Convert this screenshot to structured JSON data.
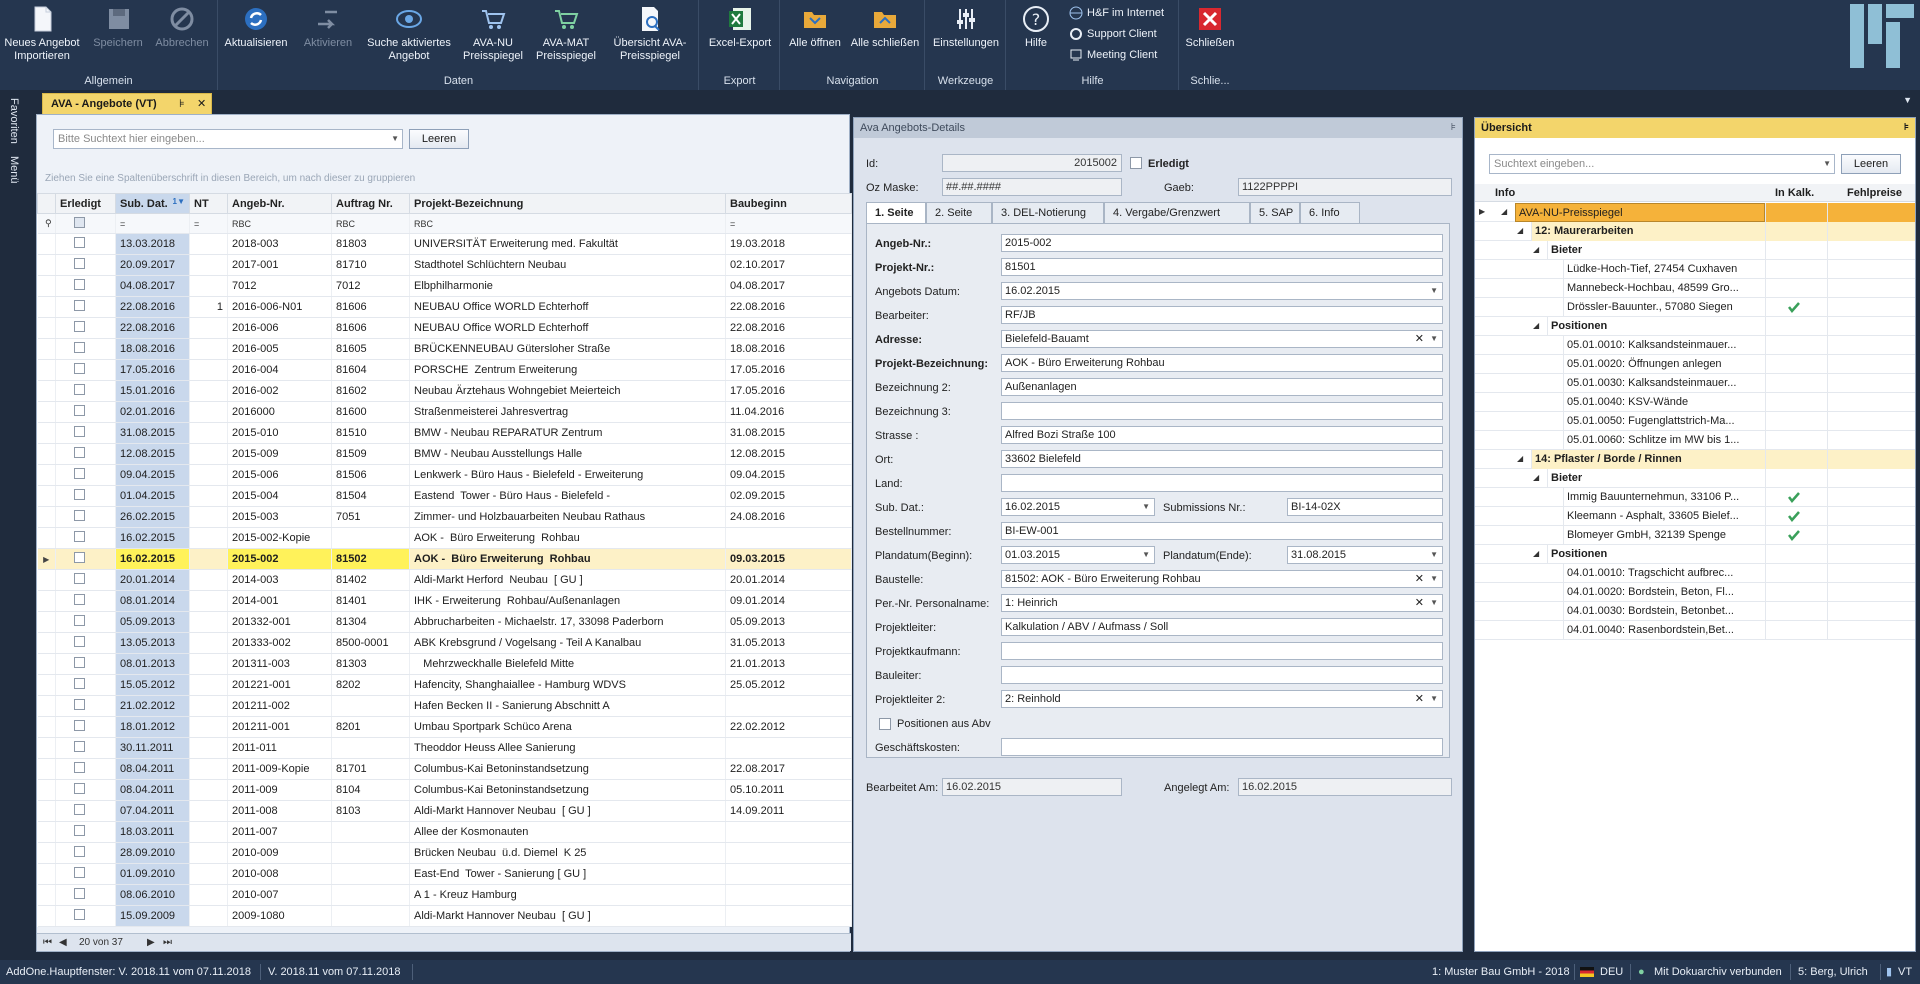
{
  "ribbon": {
    "groups": {
      "allgemein": "Allgemein",
      "daten": "Daten",
      "export": "Export",
      "navigation": "Navigation",
      "werkzeuge": "Werkzeuge",
      "hilfe": "Hilfe",
      "schliessen": "Schlie..."
    },
    "buttons": {
      "neues_angebot": "Neues Angebot Importieren",
      "speichern": "Speichern",
      "abbrechen": "Abbrechen",
      "aktualisieren": "Aktualisieren",
      "aktivieren": "Aktivieren",
      "suche": "Suche aktiviertes Angebot",
      "ava_nu": "AVA-NU Preisspiegel",
      "ava_mat": "AVA-MAT Preisspiegel",
      "uebersicht": "Übersicht AVA-Preisspiegel",
      "excel": "Excel-Export",
      "alle_oeffnen": "Alle öffnen",
      "alle_schliessen": "Alle schließen",
      "einstellungen": "Einstellungen",
      "hilfe": "Hilfe",
      "hf_internet": "H&F im Internet",
      "support": "Support Client",
      "meeting": "Meeting Client",
      "schliessen": "Schließen"
    }
  },
  "side_tabs": {
    "favoriten": "Favoriten",
    "menu": "Menü"
  },
  "doc_tab": {
    "label": "AVA - Angebote (VT)",
    "pin": "⊧",
    "close": "✕"
  },
  "left": {
    "search_placeholder": "Bitte Suchtext hier eingeben...",
    "clear_button": "Leeren",
    "group_hint": "Ziehen Sie eine Spaltenüberschrift in diesen Bereich, um nach dieser zu gruppieren",
    "columns": [
      "Erledigt",
      "Sub. Dat.",
      "NT",
      "Angeb-Nr.",
      "Auftrag Nr.",
      "Projekt-Bezeichnung",
      "Baubeginn"
    ],
    "filter_symbols": [
      "=",
      "=",
      "RBC",
      "RBC",
      "RBC",
      "="
    ],
    "sort_indicator": "1",
    "rows": [
      {
        "sub": "13.03.2018",
        "nt": "",
        "angeb": "2018-003",
        "auftrag": "81803",
        "projekt": "UNIVERSITÄT Erweiterung med. Fakultät",
        "baubeginn": "19.03.2018"
      },
      {
        "sub": "20.09.2017",
        "nt": "",
        "angeb": "2017-001",
        "auftrag": "81710",
        "projekt": "Stadthotel Schlüchtern Neubau",
        "baubeginn": "02.10.2017"
      },
      {
        "sub": "04.08.2017",
        "nt": "",
        "angeb": "7012",
        "auftrag": "7012",
        "projekt": "Elbphilharmonie",
        "baubeginn": "04.08.2017"
      },
      {
        "sub": "22.08.2016",
        "nt": "1",
        "angeb": "2016-006-N01",
        "auftrag": "81606",
        "projekt": "NEUBAU Office WORLD Echterhoff",
        "baubeginn": "22.08.2016"
      },
      {
        "sub": "22.08.2016",
        "nt": "",
        "angeb": "2016-006",
        "auftrag": "81606",
        "projekt": "NEUBAU Office WORLD Echterhoff",
        "baubeginn": "22.08.2016"
      },
      {
        "sub": "18.08.2016",
        "nt": "",
        "angeb": "2016-005",
        "auftrag": "81605",
        "projekt": "BRÜCKENNEUBAU Gütersloher Straße",
        "baubeginn": "18.08.2016"
      },
      {
        "sub": "17.05.2016",
        "nt": "",
        "angeb": "2016-004",
        "auftrag": "81604",
        "projekt": "PORSCHE  Zentrum Erweiterung",
        "baubeginn": "17.05.2016"
      },
      {
        "sub": "15.01.2016",
        "nt": "",
        "angeb": "2016-002",
        "auftrag": "81602",
        "projekt": "Neubau Ärztehaus Wohngebiet Meierteich",
        "baubeginn": "17.05.2016"
      },
      {
        "sub": "02.01.2016",
        "nt": "",
        "angeb": "2016000",
        "auftrag": "81600",
        "projekt": "Straßenmeisterei Jahresvertrag",
        "baubeginn": "11.04.2016"
      },
      {
        "sub": "31.08.2015",
        "nt": "",
        "angeb": "2015-010",
        "auftrag": "81510",
        "projekt": "BMW - Neubau REPARATUR Zentrum",
        "baubeginn": "31.08.2015"
      },
      {
        "sub": "12.08.2015",
        "nt": "",
        "angeb": "2015-009",
        "auftrag": "81509",
        "projekt": "BMW - Neubau Ausstellungs Halle",
        "baubeginn": "12.08.2015"
      },
      {
        "sub": "09.04.2015",
        "nt": "",
        "angeb": "2015-006",
        "auftrag": "81506",
        "projekt": "Lenkwerk - Büro Haus - Bielefeld - Erweiterung",
        "baubeginn": "09.04.2015"
      },
      {
        "sub": "01.04.2015",
        "nt": "",
        "angeb": "2015-004",
        "auftrag": "81504",
        "projekt": "Eastend  Tower - Büro Haus - Bielefeld -",
        "baubeginn": "02.09.2015"
      },
      {
        "sub": "26.02.2015",
        "nt": "",
        "angeb": "2015-003",
        "auftrag": "7051",
        "projekt": "Zimmer- und Holzbauarbeiten Neubau Rathaus",
        "baubeginn": "24.08.2016"
      },
      {
        "sub": "16.02.2015",
        "nt": "",
        "angeb": "2015-002-Kopie",
        "auftrag": "",
        "projekt": "AOK -  Büro Erweiterung  Rohbau",
        "baubeginn": ""
      },
      {
        "sub": "16.02.2015",
        "nt": "",
        "angeb": "2015-002",
        "auftrag": "81502",
        "projekt": "AOK -  Büro Erweiterung  Rohbau",
        "baubeginn": "09.03.2015",
        "selected": true
      },
      {
        "sub": "20.01.2014",
        "nt": "",
        "angeb": "2014-003",
        "auftrag": "81402",
        "projekt": "Aldi-Markt Herford  Neubau  [ GU ]",
        "baubeginn": "20.01.2014"
      },
      {
        "sub": "08.01.2014",
        "nt": "",
        "angeb": "2014-001",
        "auftrag": "81401",
        "projekt": "IHK - Erweiterung  Rohbau/Außenanlagen",
        "baubeginn": "09.01.2014"
      },
      {
        "sub": "05.09.2013",
        "nt": "",
        "angeb": "201332-001",
        "auftrag": "81304",
        "projekt": "Abbrucharbeiten - Michaelstr. 17, 33098 Paderborn",
        "baubeginn": "05.09.2013"
      },
      {
        "sub": "13.05.2013",
        "nt": "",
        "angeb": "201333-002",
        "auftrag": "8500-0001",
        "projekt": "ABK Krebsgrund / Vogelsang - Teil A Kanalbau",
        "baubeginn": "31.05.2013"
      },
      {
        "sub": "08.01.2013",
        "nt": "",
        "angeb": "201311-003",
        "auftrag": "81303",
        "projekt": "   Mehrzweckhalle Bielefeld Mitte",
        "baubeginn": "21.01.2013"
      },
      {
        "sub": "15.05.2012",
        "nt": "",
        "angeb": "201221-001",
        "auftrag": "8202",
        "projekt": "Hafencity, Shanghaiallee - Hamburg WDVS",
        "baubeginn": "25.05.2012"
      },
      {
        "sub": "21.02.2012",
        "nt": "",
        "angeb": "201211-002",
        "auftrag": "",
        "projekt": "Hafen Becken II - Sanierung Abschnitt A",
        "baubeginn": ""
      },
      {
        "sub": "18.01.2012",
        "nt": "",
        "angeb": "201211-001",
        "auftrag": "8201",
        "projekt": "Umbau Sportpark Schüco Arena",
        "baubeginn": "22.02.2012"
      },
      {
        "sub": "30.11.2011",
        "nt": "",
        "angeb": "2011-011",
        "auftrag": "",
        "projekt": "Theoddor Heuss Allee Sanierung",
        "baubeginn": ""
      },
      {
        "sub": "08.04.2011",
        "nt": "",
        "angeb": "2011-009-Kopie",
        "auftrag": "81701",
        "projekt": "Columbus-Kai Betoninstandsetzung",
        "baubeginn": "22.08.2017"
      },
      {
        "sub": "08.04.2011",
        "nt": "",
        "angeb": "2011-009",
        "auftrag": "8104",
        "projekt": "Columbus-Kai Betoninstandsetzung",
        "baubeginn": "05.10.2011"
      },
      {
        "sub": "07.04.2011",
        "nt": "",
        "angeb": "2011-008",
        "auftrag": "8103",
        "projekt": "Aldi-Markt Hannover Neubau  [ GU ]",
        "baubeginn": "14.09.2011"
      },
      {
        "sub": "18.03.2011",
        "nt": "",
        "angeb": "2011-007",
        "auftrag": "",
        "projekt": "Allee der Kosmonauten",
        "baubeginn": ""
      },
      {
        "sub": "28.09.2010",
        "nt": "",
        "angeb": "2010-009",
        "auftrag": "",
        "projekt": "Brücken Neubau  ü.d. Diemel  K 25",
        "baubeginn": ""
      },
      {
        "sub": "01.09.2010",
        "nt": "",
        "angeb": "2010-008",
        "auftrag": "",
        "projekt": "East-End  Tower - Sanierung [ GU ]",
        "baubeginn": ""
      },
      {
        "sub": "08.06.2010",
        "nt": "",
        "angeb": "2010-007",
        "auftrag": "",
        "projekt": "A 1 - Kreuz Hamburg",
        "baubeginn": ""
      },
      {
        "sub": "15.09.2009",
        "nt": "",
        "angeb": "2009-1080",
        "auftrag": "",
        "projekt": "Aldi-Markt Hannover Neubau  [ GU ]",
        "baubeginn": ""
      }
    ],
    "pager_text": "20 von 37"
  },
  "details": {
    "title": "Ava Angebots-Details",
    "id_label": "Id:",
    "id_value": "2015002",
    "erledigt_label": "Erledigt",
    "ozmaske_label": "Oz Maske:",
    "ozmaske_value": "##.##.####",
    "gaeb_label": "Gaeb:",
    "gaeb_value": "1122PPPPI",
    "tabs": [
      "1. Seite",
      "2. Seite",
      "3. DEL-Notierung",
      "4. Vergabe/Grenzwert",
      "5. SAP",
      "6. Info"
    ],
    "fields": {
      "angeb_nr_label": "Angeb-Nr.:",
      "angeb_nr": "2015-002",
      "projekt_nr_label": "Projekt-Nr.:",
      "projekt_nr": "81501",
      "angebots_datum_label": "Angebots Datum:",
      "angebots_datum": "16.02.2015",
      "bearbeiter_label": "Bearbeiter:",
      "bearbeiter": "RF/JB",
      "adresse_label": "Adresse:",
      "adresse": "Bielefeld-Bauamt",
      "projekt_bez_label": "Projekt-Bezeichnung:",
      "projekt_bez": "AOK -  Büro Erweiterung  Rohbau",
      "bez2_label": "Bezeichnung 2:",
      "bez2": "Außenanlagen",
      "bez3_label": "Bezeichnung 3:",
      "bez3": "",
      "strasse_label": "Strasse :",
      "strasse": "Alfred Bozi Straße 100",
      "ort_label": "Ort:",
      "ort": "33602 Bielefeld",
      "land_label": "Land:",
      "land": "",
      "sub_dat_label": "Sub. Dat.:",
      "sub_dat": "16.02.2015",
      "submissions_nr_label": "Submissions Nr.:",
      "submissions_nr": "BI-14-02X",
      "bestellnummer_label": "Bestellnummer:",
      "bestellnummer": "BI-EW-001",
      "plandatum_beginn_label": "Plandatum(Beginn):",
      "plandatum_beginn": "01.03.2015",
      "plandatum_ende_label": "Plandatum(Ende):",
      "plandatum_ende": "31.08.2015",
      "baustelle_label": "Baustelle:",
      "baustelle": "81502: AOK -  Büro Erweiterung  Rohbau",
      "personal_label": "Per.-Nr. Personalname:",
      "personal": "1: Heinrich",
      "projektleiter_label": "Projektleiter:",
      "projektleiter": "Kalkulation / ABV / Aufmass / Soll",
      "projektkaufmann_label": "Projektkaufmann:",
      "projektkaufmann": "",
      "bauleiter_label": "Bauleiter:",
      "bauleiter": "",
      "projektleiter2_label": "Projektleiter 2:",
      "projektleiter2": "2: Reinhold",
      "positionen_abv_label": "Positionen aus Abv",
      "geschaeftskosten_label": "Geschäftskosten:",
      "geschaeftskosten": ""
    },
    "bearbeitet_label": "Bearbeitet Am:",
    "bearbeitet": "16.02.2015",
    "angelegt_label": "Angelegt Am:",
    "angelegt": "16.02.2015"
  },
  "overview": {
    "title": "Übersicht",
    "search_placeholder": "Suchtext eingeben...",
    "clear_button": "Leeren",
    "columns": [
      "Info",
      "In Kalk.",
      "Fehlpreise"
    ],
    "tree": [
      {
        "level": 0,
        "text": "AVA-NU-Preisspiegel",
        "kind": "top",
        "exp": "◢"
      },
      {
        "level": 1,
        "text": "12: Maurerarbeiten",
        "kind": "grp",
        "exp": "◢"
      },
      {
        "level": 2,
        "text": "Bieter",
        "kind": "sub",
        "exp": "◢"
      },
      {
        "level": 3,
        "text": "Lüdke-Hoch-Tief, 27454 Cuxhaven",
        "kind": "leaf"
      },
      {
        "level": 3,
        "text": "Mannebeck-Hochbau, 48599 Gro...",
        "kind": "leaf"
      },
      {
        "level": 3,
        "text": "Drössler-Bauunter., 57080 Siegen",
        "kind": "leaf",
        "check": true
      },
      {
        "level": 2,
        "text": "Positionen",
        "kind": "sub",
        "exp": "◢"
      },
      {
        "level": 3,
        "text": "05.01.0010: Kalksandsteinmauer...",
        "kind": "leaf"
      },
      {
        "level": 3,
        "text": "05.01.0020: Öffnungen anlegen",
        "kind": "leaf"
      },
      {
        "level": 3,
        "text": "05.01.0030: Kalksandsteinmauer...",
        "kind": "leaf"
      },
      {
        "level": 3,
        "text": "05.01.0040: KSV-Wände",
        "kind": "leaf"
      },
      {
        "level": 3,
        "text": "05.01.0050: Fugenglattstrich-Ma...",
        "kind": "leaf"
      },
      {
        "level": 3,
        "text": "05.01.0060: Schlitze im MW bis 1...",
        "kind": "leaf"
      },
      {
        "level": 1,
        "text": "14: Pflaster / Borde / Rinnen",
        "kind": "grp",
        "exp": "◢"
      },
      {
        "level": 2,
        "text": "Bieter",
        "kind": "sub",
        "exp": "◢"
      },
      {
        "level": 3,
        "text": "Immig Bauunternehmun, 33106 P...",
        "kind": "leaf",
        "check": true
      },
      {
        "level": 3,
        "text": "Kleemann - Asphalt, 33605 Bielef...",
        "kind": "leaf",
        "check": true
      },
      {
        "level": 3,
        "text": "Blomeyer GmbH, 32139 Spenge",
        "kind": "leaf",
        "check": true
      },
      {
        "level": 2,
        "text": "Positionen",
        "kind": "sub",
        "exp": "◢"
      },
      {
        "level": 3,
        "text": "04.01.0010: Tragschicht aufbrec...",
        "kind": "leaf"
      },
      {
        "level": 3,
        "text": "04.01.0020: Bordstein, Beton, Fl...",
        "kind": "leaf"
      },
      {
        "level": 3,
        "text": "04.01.0030: Bordstein, Betonbet...",
        "kind": "leaf"
      },
      {
        "level": 3,
        "text": "04.01.0040: Rasenbordstein,Bet...",
        "kind": "leaf"
      }
    ]
  },
  "status": {
    "hauptfenster": "AddOne.Hauptfenster: V. 2018.11 vom 07.11.2018",
    "version": "V. 2018.11 vom 07.11.2018",
    "firma": "1: Muster Bau GmbH - 2018",
    "sprache": "DEU",
    "dokuarchiv": "Mit Dokuarchiv verbunden",
    "benutzer": "5: Berg, Ulrich",
    "vt": "VT"
  },
  "colors": {
    "ribbon_bg": "#25364f",
    "accent_yellow": "#f3d56b",
    "selection_yellow": "#fff25a",
    "tree_top": "#f5b23a",
    "check_green": "#3aa05a"
  }
}
